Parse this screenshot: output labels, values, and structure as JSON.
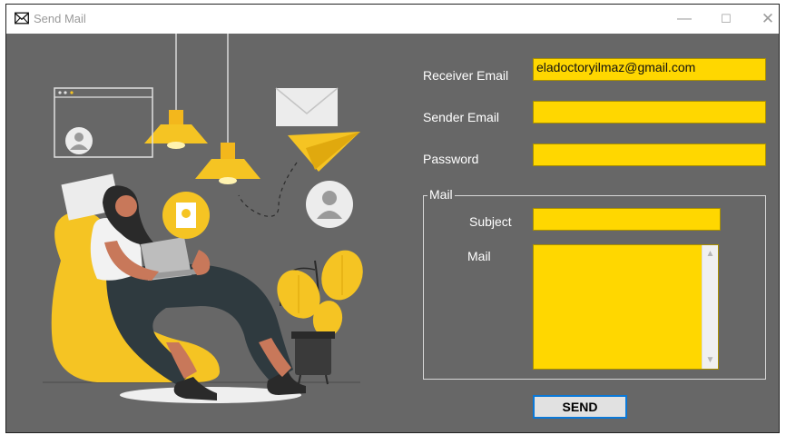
{
  "window": {
    "title": "Send Mail",
    "controls": {
      "minimize": "—",
      "maximize": "☐",
      "close": "✕"
    }
  },
  "form": {
    "receiver_label": "Receiver Email",
    "receiver_value": "eladoctoryilmaz@gmail.com",
    "sender_label": "Sender Email",
    "sender_value": "",
    "password_label": "Password",
    "password_value": "",
    "group_title": "Mail",
    "subject_label": "Subject",
    "subject_value": "",
    "mail_label": "Mail",
    "mail_value": "",
    "send_button": "SEND"
  },
  "colors": {
    "accent": "#ffd700",
    "background": "#676767",
    "button_border": "#0a78d7"
  },
  "icons": [
    "envelope-icon",
    "minimize-icon",
    "maximize-icon",
    "close-icon",
    "scroll-up-icon",
    "scroll-down-icon"
  ]
}
